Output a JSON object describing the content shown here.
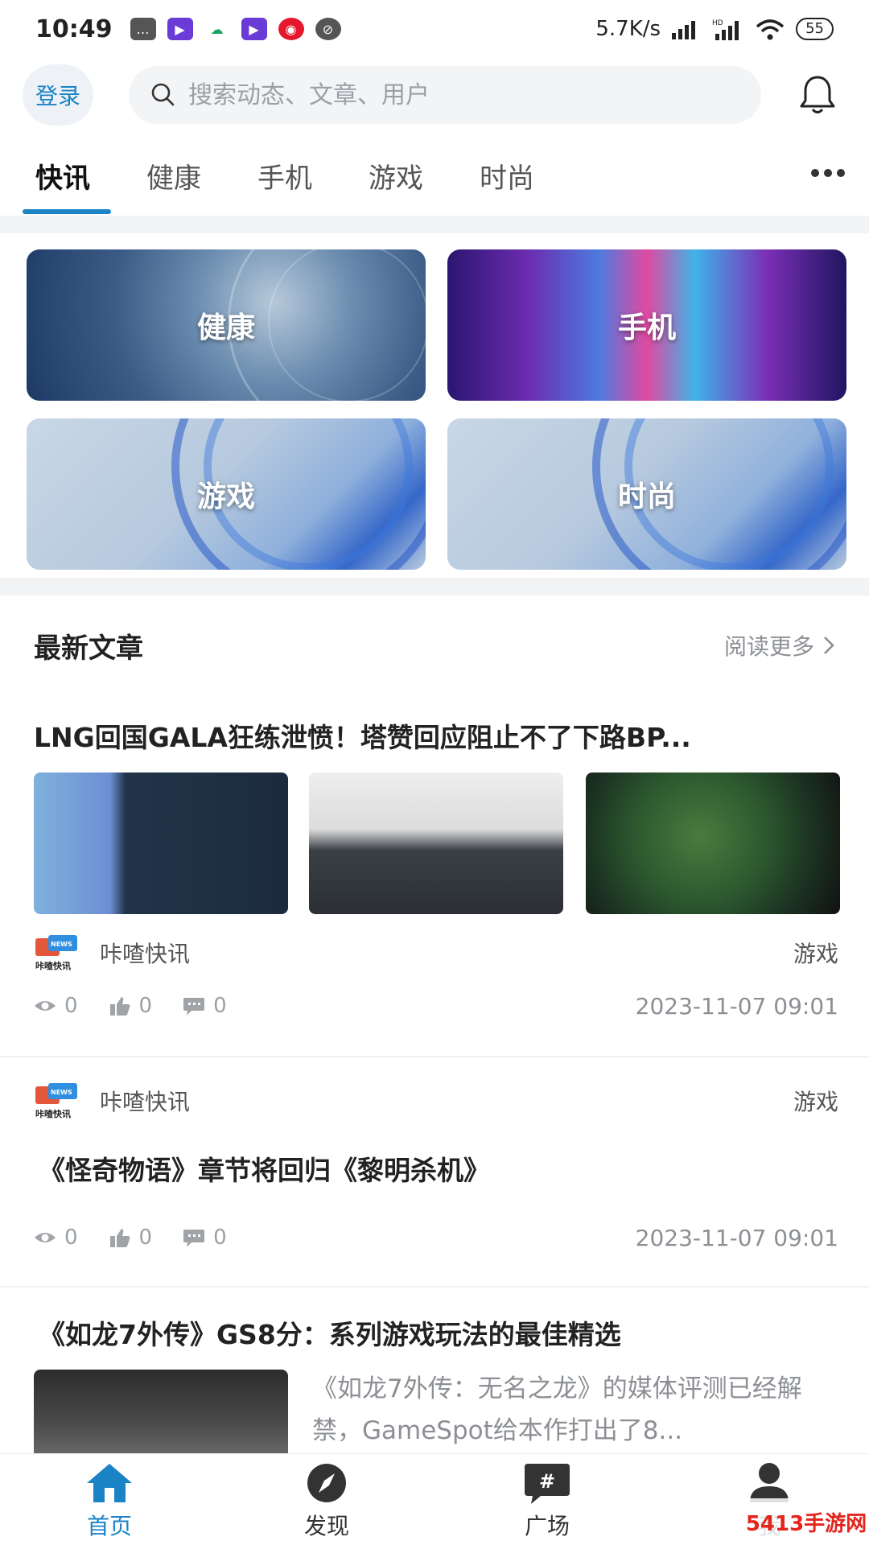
{
  "status_bar": {
    "time": "10:49",
    "net_speed": "5.7K/s",
    "battery": "55"
  },
  "header": {
    "login_label": "登录",
    "search_placeholder": "搜索动态、文章、用户"
  },
  "tabs": [
    {
      "label": "快讯",
      "active": true
    },
    {
      "label": "健康",
      "active": false
    },
    {
      "label": "手机",
      "active": false
    },
    {
      "label": "游戏",
      "active": false
    },
    {
      "label": "时尚",
      "active": false
    }
  ],
  "categories": [
    {
      "label": "健康"
    },
    {
      "label": "手机"
    },
    {
      "label": "游戏"
    },
    {
      "label": "时尚"
    }
  ],
  "section": {
    "title": "最新文章",
    "read_more": "阅读更多"
  },
  "articles": [
    {
      "title": "LNG回国GALA狂练泄愤！塔赞回应阻止不了下路BP...",
      "source": "咔喳快讯",
      "category": "游戏",
      "views": "0",
      "likes": "0",
      "comments": "0",
      "date": "2023-11-07 09:01"
    },
    {
      "title": "《怪奇物语》章节将回归《黎明杀机》",
      "source": "咔喳快讯",
      "category": "游戏",
      "views": "0",
      "likes": "0",
      "comments": "0",
      "date": "2023-11-07 09:01"
    },
    {
      "title": "《如龙7外传》GS8分：系列游戏玩法的最佳精选",
      "description": "《如龙7外传：无名之龙》的媒体评测已经解禁，GameSpot给本作打出了8..."
    }
  ],
  "bottom_nav": [
    {
      "label": "首页",
      "active": true
    },
    {
      "label": "发现",
      "active": false
    },
    {
      "label": "广场",
      "active": false
    },
    {
      "label": "我",
      "active": false
    }
  ],
  "watermark": "5413手游网",
  "logo_text": {
    "badge": "NEWS",
    "caption": "咔喳快讯"
  },
  "colors": {
    "accent": "#1a83c6",
    "text_primary": "#222222",
    "text_secondary": "#8c8f94",
    "separator": "#f2f3f5"
  }
}
